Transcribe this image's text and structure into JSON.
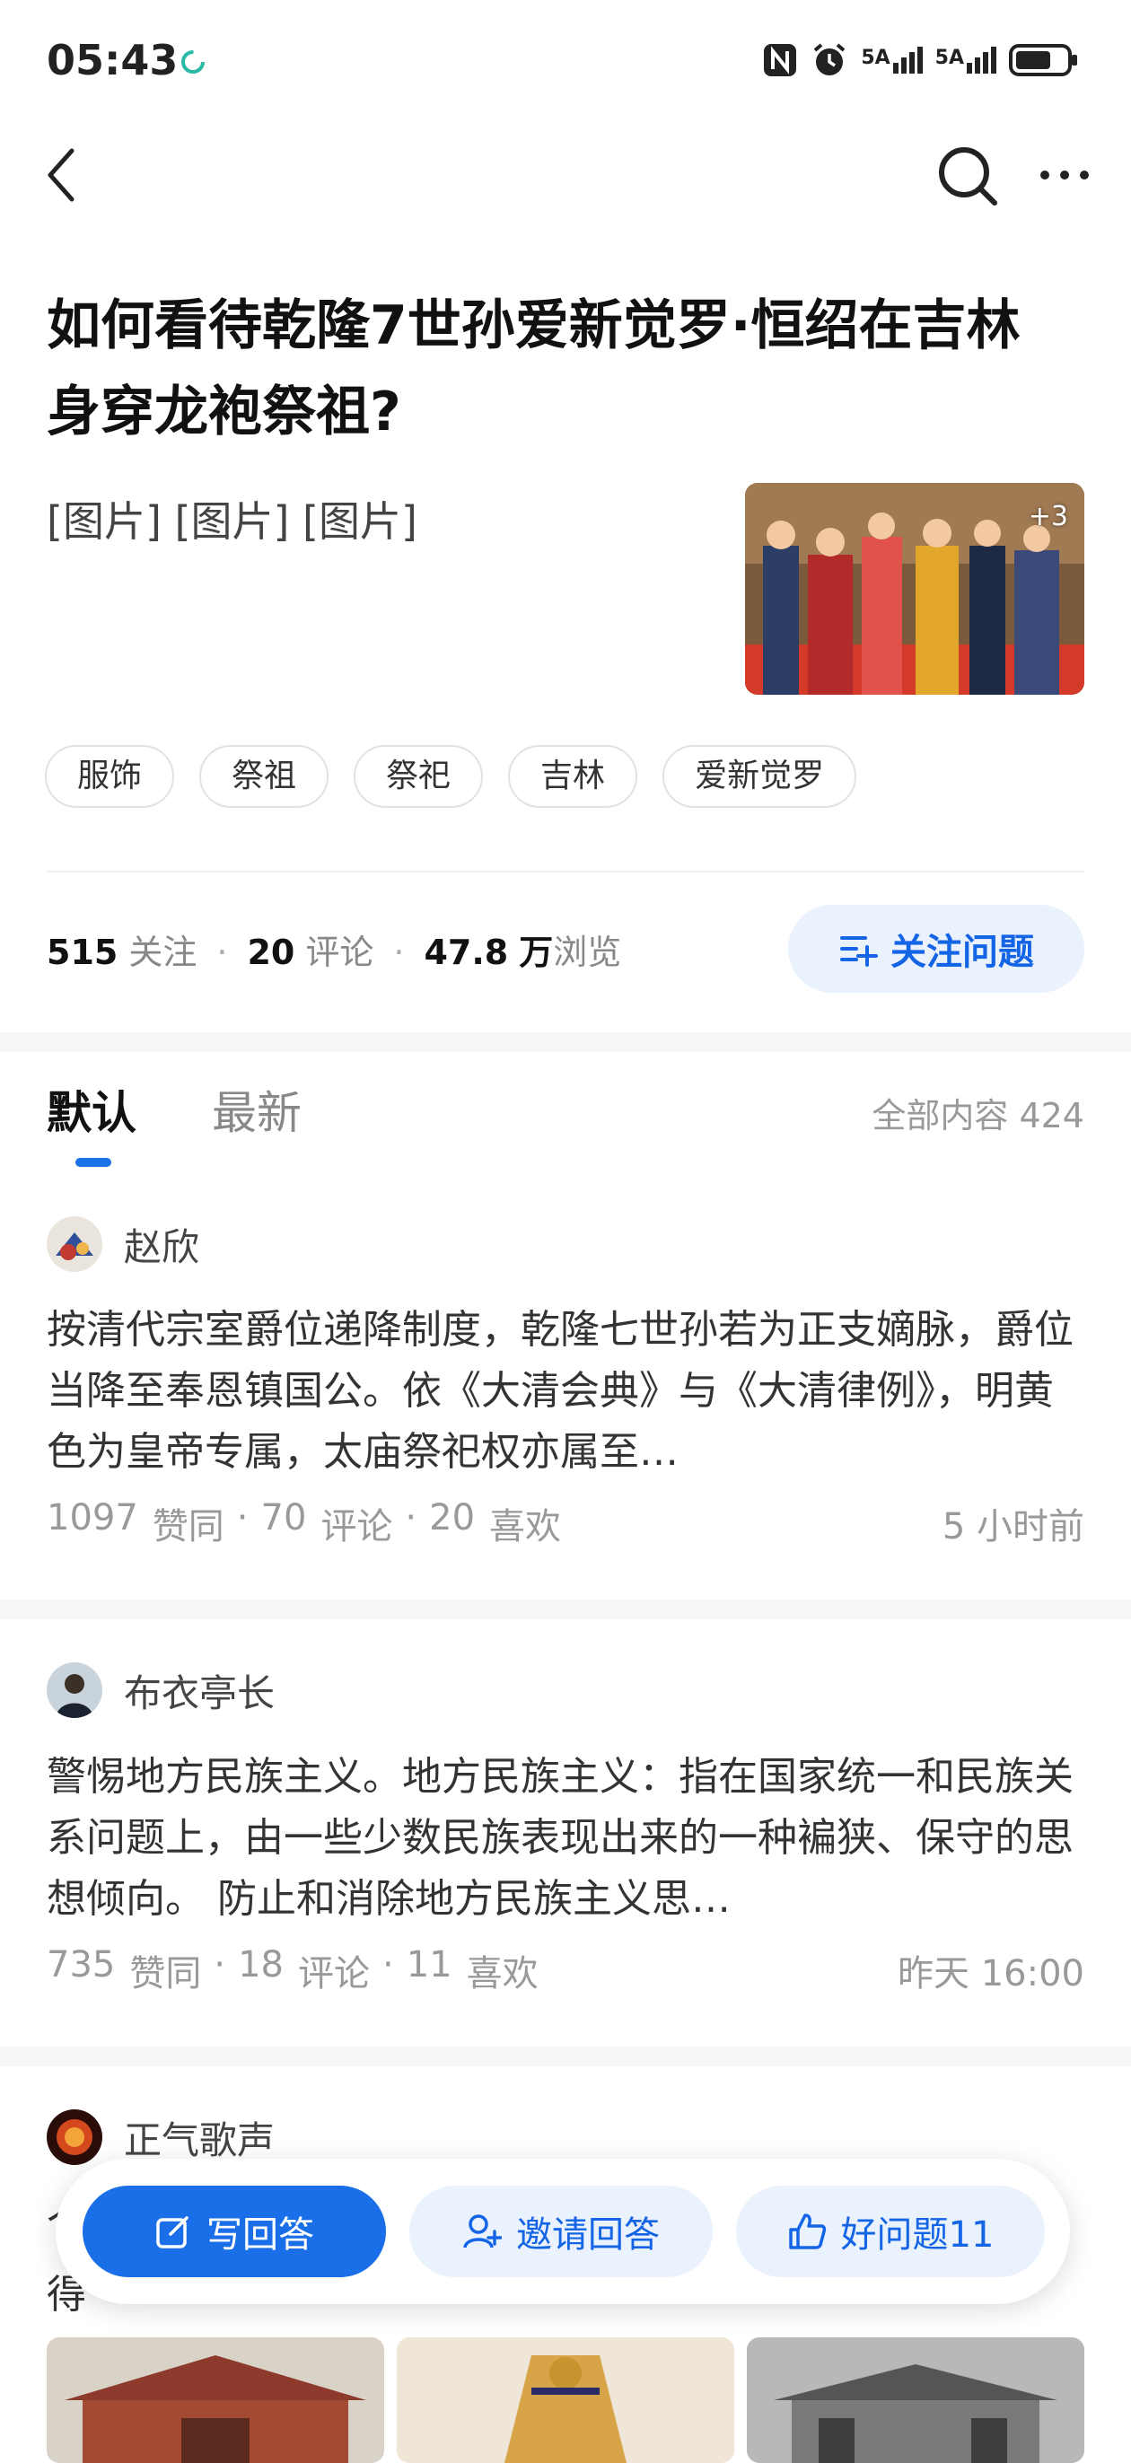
{
  "status_bar": {
    "time": "05:43",
    "signal1": "5A",
    "signal2": "5A"
  },
  "question": {
    "title": "如何看待乾隆7世孙爱新觉罗·恒绍在吉林身穿龙袍祭祖?",
    "images_placeholder": "[图片] [图片] [图片]",
    "thumb_more": "+3",
    "tags": [
      "服饰",
      "祭祖",
      "祭祀",
      "吉林",
      "爱新觉罗"
    ],
    "stats": {
      "follow_count": "515",
      "follow_label": "关注",
      "comment_count": "20",
      "comment_label": "评论",
      "view_count": "47.8",
      "view_unit": "万",
      "view_label": "浏览"
    },
    "follow_button": "关注问题"
  },
  "tabs": {
    "default": "默认",
    "latest": "最新",
    "total": "全部内容 424"
  },
  "answers": [
    {
      "author": "赵欣",
      "text": "按清代宗室爵位递降制度，乾隆七世孙若为正支嫡脉，爵位当降至奉恩镇国公。依《大清会典》与《大清律例》，明黄色为皇帝专属，太庙祭祀权亦属至…",
      "likes": "1097",
      "likes_label": "赞同",
      "comments": "70",
      "comments_label": "评论",
      "favs": "20",
      "favs_label": "喜欢",
      "time": "5 小时前"
    },
    {
      "author": "布衣亭长",
      "text": "警惕地方民族主义。地方民族主义：指在国家统一和民族关系问题上，由一些少数民族表现出来的一种褊狭、保守的思想倾向。 防止和消除地方民族主义思…",
      "likes": "735",
      "likes_label": "赞同",
      "comments": "18",
      "comments_label": "评论",
      "favs": "11",
      "favs_label": "喜欢",
      "time": "昨天 16:00"
    },
    {
      "author": "正气歌声",
      "text_line1": "个",
      "text_line2": "得"
    }
  ],
  "action_bar": {
    "write_answer": "写回答",
    "invite_answer": "邀请回答",
    "good_question": "好问题11"
  }
}
